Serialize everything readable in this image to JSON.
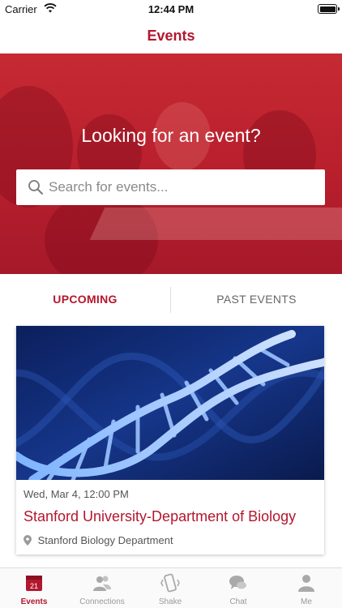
{
  "status_bar": {
    "carrier": "Carrier",
    "time": "12:44 PM"
  },
  "nav": {
    "title": "Events"
  },
  "hero": {
    "title": "Looking for an event?"
  },
  "search": {
    "placeholder": "Search for events..."
  },
  "tabs": {
    "upcoming": "UPCOMING",
    "past": "PAST EVENTS"
  },
  "events": [
    {
      "date": "Wed, Mar 4, 12:00 PM",
      "title": "Stanford University-Department of Biology",
      "location": "Stanford Biology Department"
    }
  ],
  "tab_bar": {
    "calendar_day": "21",
    "items": [
      {
        "label": "Events",
        "icon": "calendar-icon"
      },
      {
        "label": "Connections",
        "icon": "people-icon"
      },
      {
        "label": "Shake",
        "icon": "shake-phone-icon"
      },
      {
        "label": "Chat",
        "icon": "chat-bubbles-icon"
      },
      {
        "label": "Me",
        "icon": "person-icon"
      }
    ]
  },
  "colors": {
    "accent": "#b3172e",
    "hero": "#c62a33"
  }
}
